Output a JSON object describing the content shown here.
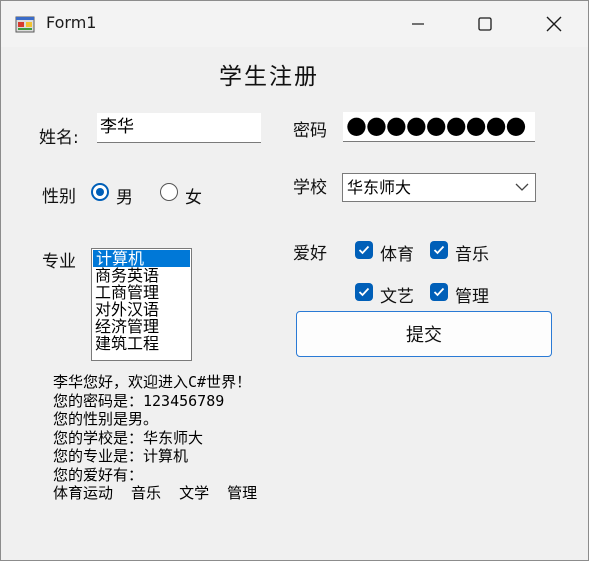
{
  "window": {
    "title": "Form1"
  },
  "form": {
    "heading": "学生注册",
    "name_label": "姓名:",
    "name_value": "李华",
    "password_label": "密码",
    "password_display": "●●●●●●●●●",
    "gender_label": "性别",
    "gender_options": [
      {
        "label": "男",
        "selected": true
      },
      {
        "label": "女",
        "selected": false
      }
    ],
    "school_label": "学校",
    "school_value": "华东师大",
    "major_label": "专业",
    "majors": [
      {
        "label": "计算机",
        "selected": true
      },
      {
        "label": "商务英语",
        "selected": false
      },
      {
        "label": "工商管理",
        "selected": false
      },
      {
        "label": "对外汉语",
        "selected": false
      },
      {
        "label": "经济管理",
        "selected": false
      },
      {
        "label": "建筑工程",
        "selected": false
      }
    ],
    "hobby_label": "爱好",
    "hobbies": [
      {
        "label": "体育",
        "checked": true
      },
      {
        "label": "音乐",
        "checked": true
      },
      {
        "label": "文艺",
        "checked": true
      },
      {
        "label": "管理",
        "checked": true
      }
    ],
    "submit_label": "提交"
  },
  "output": {
    "lines": [
      "李华您好，欢迎进入C#世界！",
      "您的密码是：123456789",
      "您的性别是男。",
      "您的学校是：华东师大",
      "您的专业是：计算机",
      "您的爱好有：",
      "体育运动  音乐  文学  管理"
    ]
  },
  "colors": {
    "accent": "#005fb8",
    "selection": "#0078d7",
    "background": "#f0f0f0"
  }
}
